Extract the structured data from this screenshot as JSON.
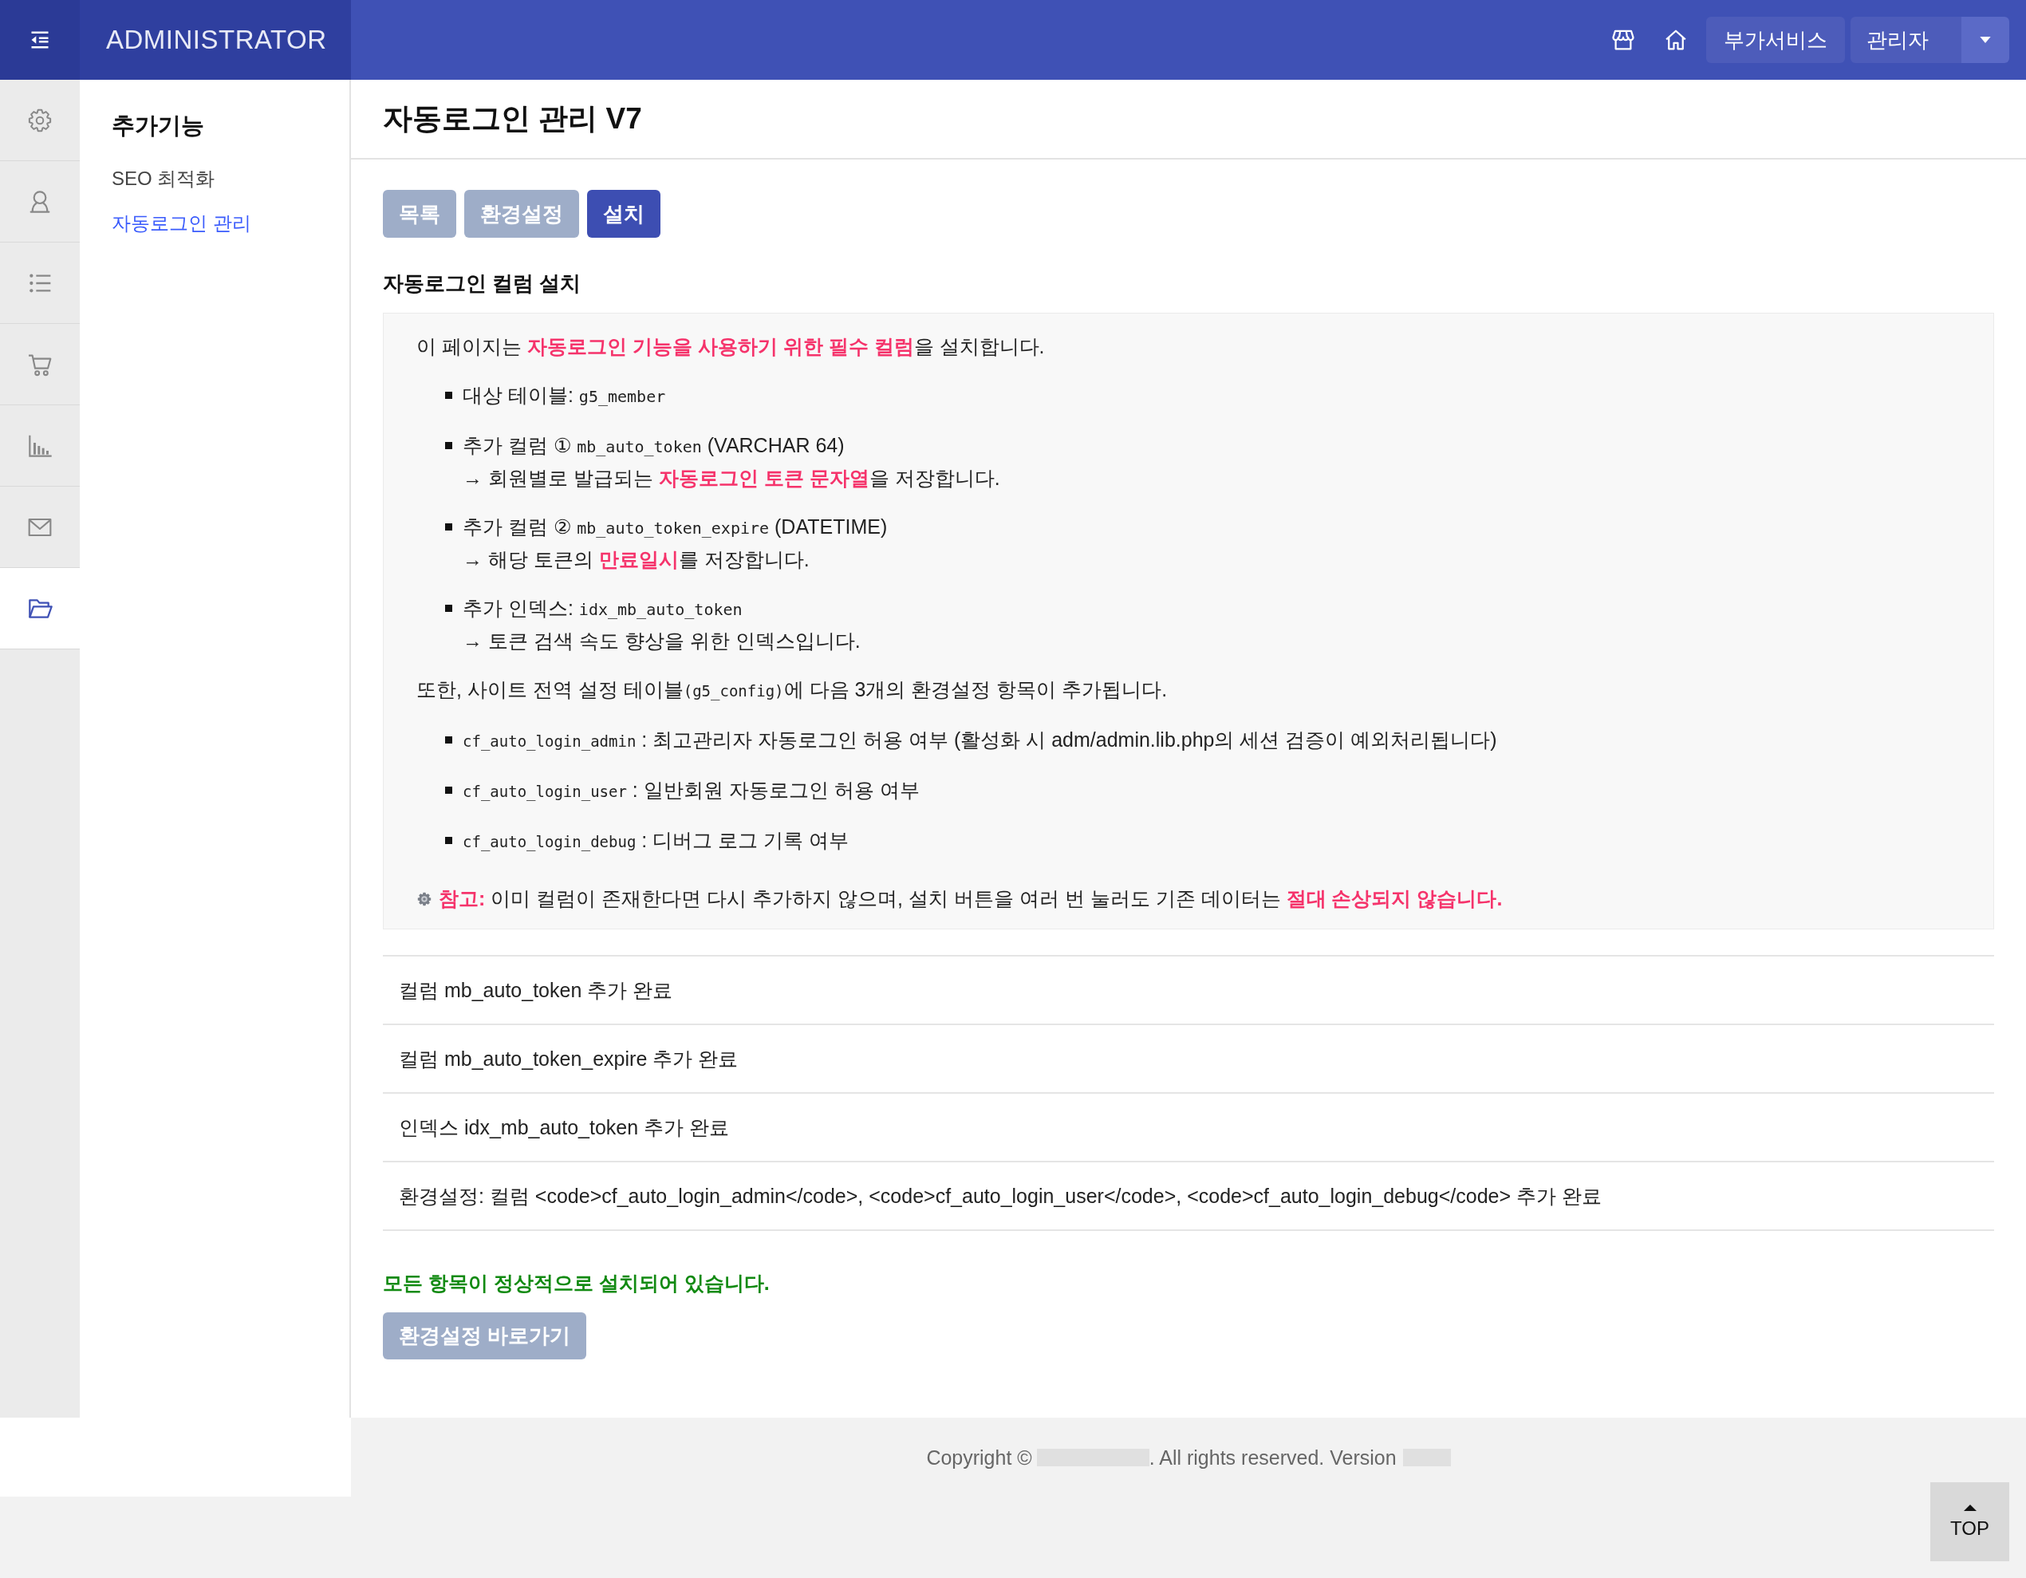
{
  "header": {
    "brand": "ADMINISTRATOR",
    "service_button": "부가서비스",
    "user_button": "관리자"
  },
  "icon_sidebar": [
    {
      "selected": false
    },
    {
      "selected": false
    },
    {
      "selected": false
    },
    {
      "selected": false
    },
    {
      "selected": false
    },
    {
      "selected": false
    },
    {
      "selected": true
    }
  ],
  "submenu": {
    "title": "추가기능",
    "items": [
      {
        "label": "SEO 최적화",
        "selected": false
      },
      {
        "label": "자동로그인 관리",
        "selected": true
      }
    ]
  },
  "page_title": "자동로그인 관리 V7",
  "tabs": [
    {
      "label": "목록",
      "selected": false
    },
    {
      "label": "환경설정",
      "selected": false
    },
    {
      "label": "설치",
      "selected": true
    }
  ],
  "section_title": "자동로그인 컬럼 설치",
  "info": {
    "intro": "이 페이지는 **자동로그인 기능을 사용하기 위한 필수 컬럼**을 설치합니다.",
    "items": [
      {
        "label": "대상 테이블:",
        "code": "g5_member"
      },
      {
        "label": "추가 컬럼 ①",
        "code": "mb_auto_token",
        "suffix": "(VARCHAR 64)",
        "note": "→ 회원별로 발급되는 **자동로그인 토큰 문자열**을 저장합니다."
      },
      {
        "label": "추가 컬럼 ②",
        "code": "mb_auto_token_expire",
        "suffix": "(DATETIME)",
        "note": "→ 해당 토큰의 **만료일시**를 저장합니다."
      },
      {
        "label": "추가 인덱스:",
        "code": "idx_mb_auto_token",
        "note": "→ 토큰 검색 속도 향상을 위한 인덱스입니다."
      }
    ],
    "config_intro": {
      "before": "또한, 사이트 전역 설정 테이블",
      "code": "(g5_config)",
      "after": "에 다음 3개의 환경설정 항목이 추가됩니다."
    },
    "config_items": [
      {
        "code": "cf_auto_login_admin",
        "text": ": 최고관리자 자동로그인 허용 여부 (활성화 시 adm/admin.lib.php의 세션 검증이 예외처리됩니다)"
      },
      {
        "code": "cf_auto_login_user",
        "text": ": 일반회원 자동로그인 허용 여부"
      },
      {
        "code": "cf_auto_login_debug",
        "text": ": 디버그 로그 기록 여부"
      }
    ],
    "note": "**참고:** 이미 컬럼이 존재한다면 다시 추가하지 않으며, 설치 버튼을 여러 번 눌러도 기존 데이터는 **절대 손상되지 않습니다.**"
  },
  "results": [
    "컬럼 mb_auto_token 추가 완료",
    "컬럼 mb_auto_token_expire 추가 완료",
    "인덱스 idx_mb_auto_token 추가 완료",
    "환경설정: 컬럼 <code>cf_auto_login_admin</code>, <code>cf_auto_login_user</code>, <code>cf_auto_login_debug</code> 추가 완료"
  ],
  "success_message": "모든 항목이 정상적으로 설치되어 있습니다.",
  "config_button": "환경설정 바로가기",
  "footer": {
    "copyright_prefix": "Copyright ©",
    "copyright_suffix": ". All rights reserved. Version",
    "top_button": "TOP"
  }
}
